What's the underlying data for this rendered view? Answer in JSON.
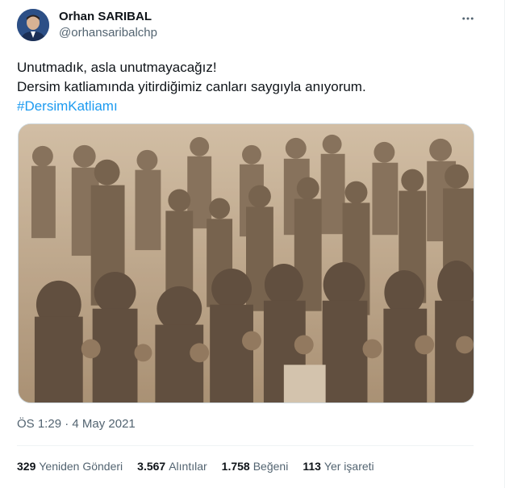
{
  "author": {
    "name": "Orhan SARIBAL",
    "handle": "@orhansaribalchp"
  },
  "tweet": {
    "line1": "Unutmadık, asla unutmayacağız!",
    "line2": "Dersim katliamında yitirdiğimiz canları saygıyla anıyorum.",
    "hashtag": "#DersimKatliamı"
  },
  "meta": {
    "timestamp": "ÖS 1:29 · 4 May 2021"
  },
  "stats": {
    "retweets_count": "329",
    "retweets_label": "Yeniden Gönderi",
    "quotes_count": "3.567",
    "quotes_label": "Alıntılar",
    "likes_count": "1.758",
    "likes_label": "Beğeni",
    "bookmarks_count": "113",
    "bookmarks_label": "Yer işareti"
  },
  "icons": {
    "more": "more-dots-icon"
  },
  "colors": {
    "link": "#1d9bf0",
    "secondary_text": "#536471",
    "primary_text": "#0f1419",
    "photo_tone": "#b9a48a"
  }
}
